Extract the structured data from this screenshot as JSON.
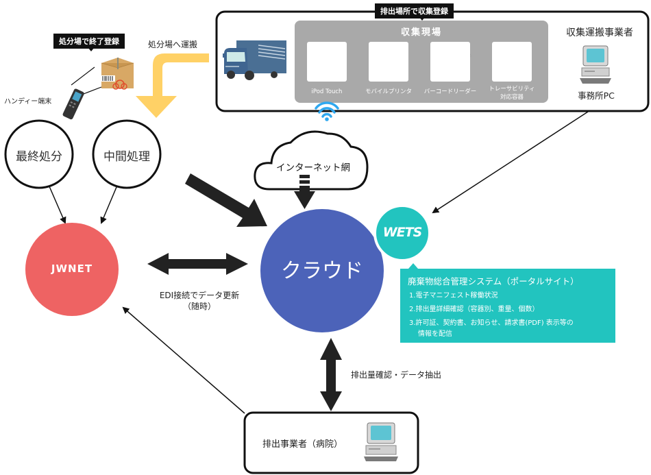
{
  "collection_box": {
    "tag": "排出場所で収集登録",
    "site_title": "収集現場",
    "devices": [
      {
        "label": "iPod Touch",
        "icon": "ipod-touch"
      },
      {
        "label": "モバイルプリンタ",
        "icon": "mobile-printer"
      },
      {
        "label": "バーコードリーダー",
        "icon": "barcode-reader"
      },
      {
        "label": "トレーサビリティ\n対応容器",
        "label_line1": "トレーサビリティ",
        "label_line2": "対応容器",
        "icon": "container"
      }
    ],
    "carrier_title": "収集運搬事業者",
    "carrier_pc_label": "事務所PC"
  },
  "disposal": {
    "tag": "処分場で終了登録",
    "handy_label": "ハンディー端末",
    "transport_label": "処分場へ運搬"
  },
  "nodes": {
    "final_disposal": "最終処分",
    "intermediate": "中間処理",
    "internet": "インターネット網",
    "jwnet": "JWNET",
    "cloud": "クラウド",
    "wets": "WETS"
  },
  "edges": {
    "edi_line1": "EDI接続でデータ更新",
    "edi_line2": "（随時）",
    "extract": "排出量確認・データ抽出"
  },
  "portal": {
    "title": "廃棄物総合管理システム（ポータルサイト）",
    "items": [
      "1.電子マニフェスト稼働状況",
      "2.排出量詳細確認（容器別、重量、個数）",
      "3.許可証、契約書、お知らせ、請求書(PDF) 表示等の"
    ],
    "item3_cont": "情報を配信"
  },
  "emitter": {
    "label": "排出事業者（病院）"
  },
  "colors": {
    "jwnet": "#ee6363",
    "cloud": "#4c63b9",
    "wets": "#22c4bf",
    "portal_bg": "#22c4bf",
    "transport_arrow": "#ffd166",
    "site_bg": "#a9a9a9",
    "truck": "#4a6f94",
    "wifi": "#2fa8f0",
    "dark_arrow": "#222222"
  }
}
